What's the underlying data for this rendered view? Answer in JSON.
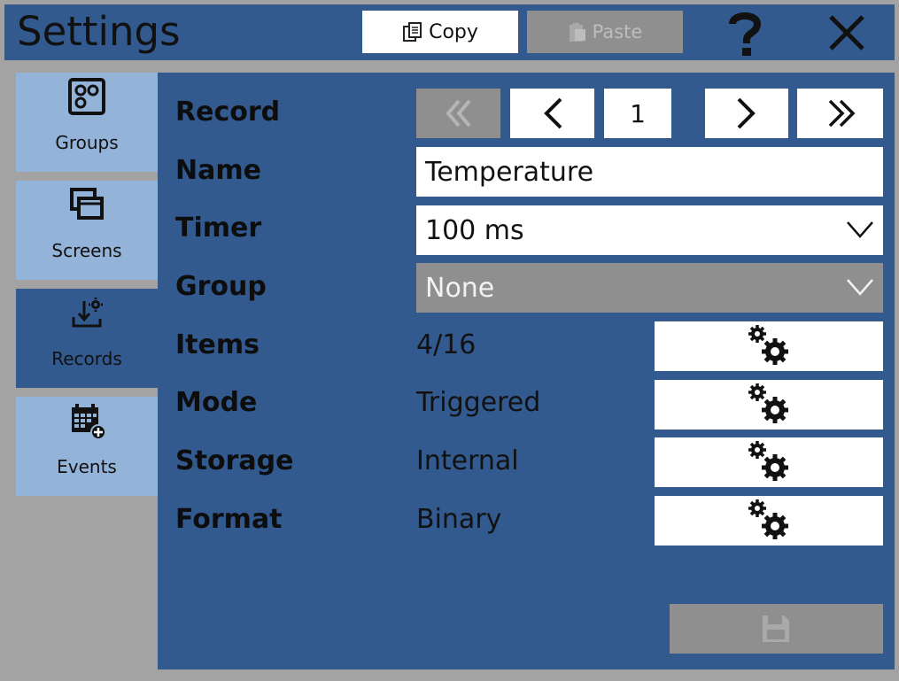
{
  "window": {
    "title": "Settings"
  },
  "toolbar": {
    "copy_label": "Copy",
    "paste_label": "Paste",
    "help_icon": "question-icon",
    "close_icon": "close-icon"
  },
  "sidebar": {
    "items": [
      {
        "label": "Groups",
        "icon": "groups-icon",
        "active": false
      },
      {
        "label": "Screens",
        "icon": "screens-icon",
        "active": false
      },
      {
        "label": "Records",
        "icon": "records-icon",
        "active": true
      },
      {
        "label": "Events",
        "icon": "events-icon",
        "active": false
      }
    ]
  },
  "form": {
    "record": {
      "label": "Record",
      "value": "1"
    },
    "name": {
      "label": "Name",
      "value": "Temperature"
    },
    "timer": {
      "label": "Timer",
      "value": "100 ms"
    },
    "group": {
      "label": "Group",
      "value": "None"
    },
    "items": {
      "label": "Items",
      "value": "4/16"
    },
    "mode": {
      "label": "Mode",
      "value": "Triggered"
    },
    "storage": {
      "label": "Storage",
      "value": "Internal"
    },
    "format": {
      "label": "Format",
      "value": "Binary"
    }
  },
  "colors": {
    "panel": "#325a8f",
    "sidebar_inactive": "#93b3d9",
    "disabled": "#8f8f8f",
    "background": "#a3a3a3"
  }
}
